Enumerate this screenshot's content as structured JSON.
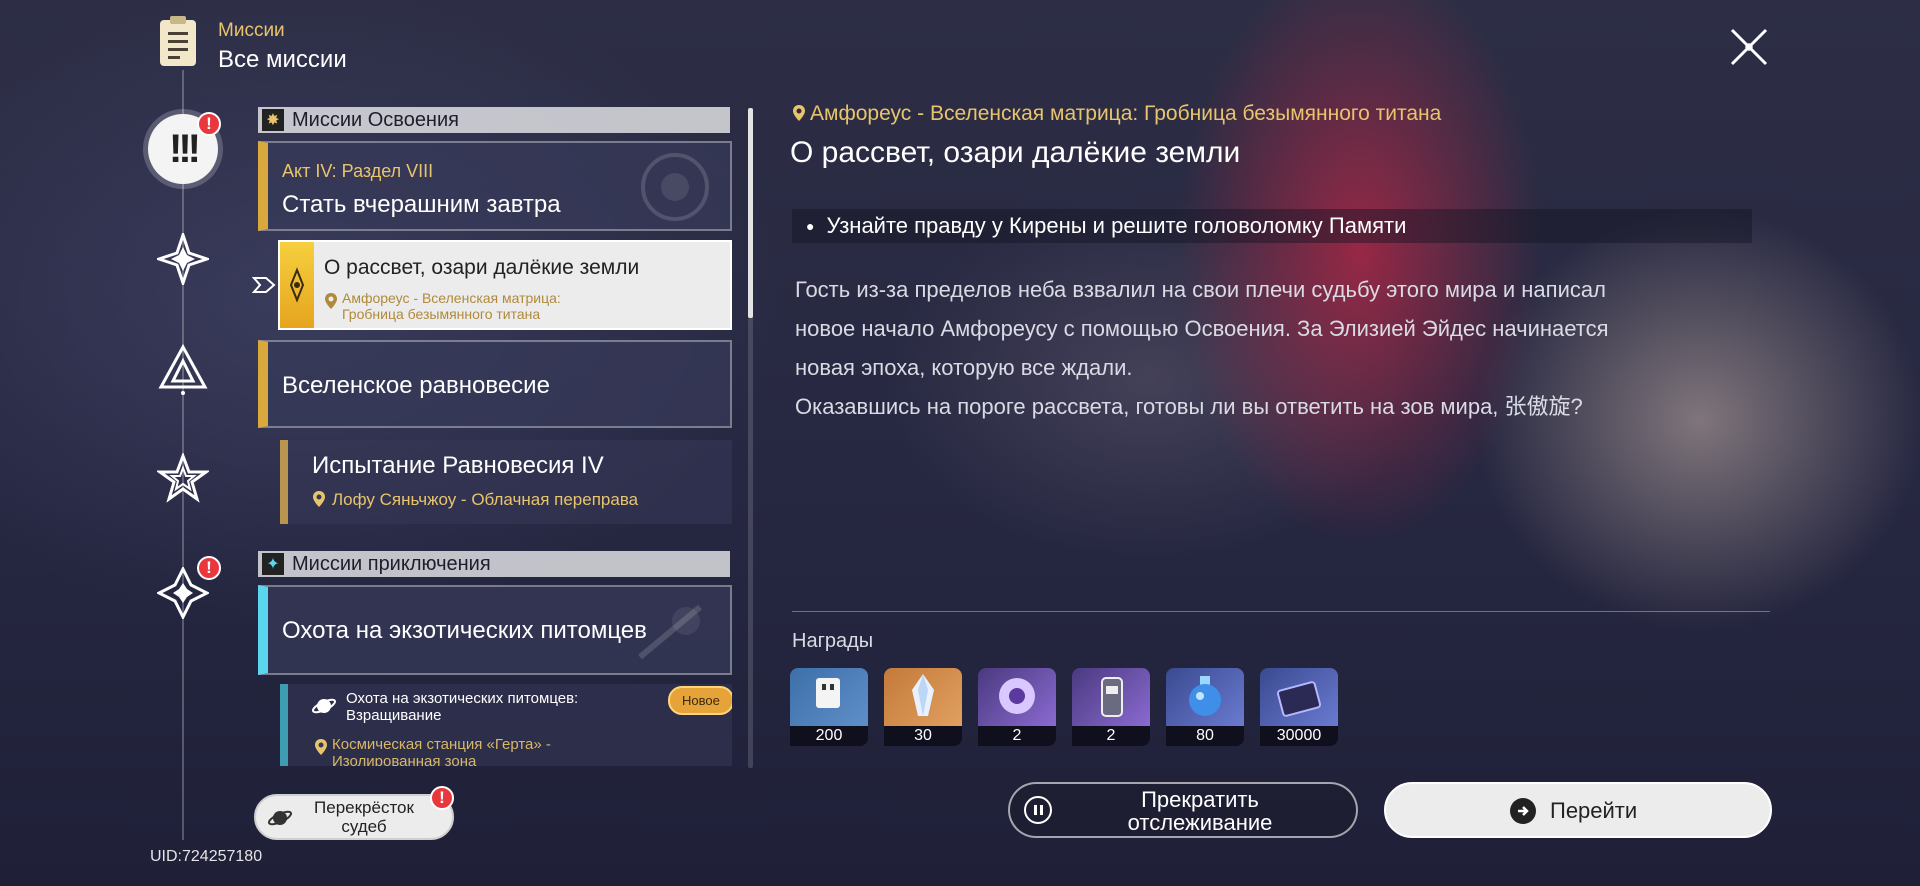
{
  "header": {
    "section": "Миссии",
    "title": "Все миссии"
  },
  "sections": {
    "trailblaze": "Миссии Освоения",
    "adventure": "Миссии приключения"
  },
  "quests": {
    "act": {
      "chapter": "Акт IV: Раздел VIII",
      "title": "Стать вчерашним завтра"
    },
    "selected": {
      "title": "О рассвет, озари далёкие земли",
      "location": "Амфореус - Вселенская матрица: Гробница безымянного титана"
    },
    "equilibrium": {
      "title": "Вселенское равновесие"
    },
    "trial": {
      "title": "Испытание Равновесия IV",
      "location": "Лофу Сяньчжоу - Облачная переправа"
    },
    "pets": {
      "title": "Охота на экзотических питомцев"
    },
    "pets_sub": {
      "title": "Охота на экзотических питомцев: Взращивание",
      "badge": "Новое",
      "location": "Космическая станция «Герта» - Изолированная зона"
    }
  },
  "detail": {
    "location": "Амфореус - Вселенская матрица: Гробница безымянного титана",
    "title": "О рассвет, озари далёкие земли",
    "objective": "Узнайте правду у Кирены и решите головоломку Памяти",
    "description_lines": [
      "Гость из-за пределов неба взвалил на свои плечи судьбу этого мира и написал",
      "новое начало Амфореусу с помощью Освоения. За Элизией Эйдес начинается",
      "новая эпоха, которую все ждали.",
      "Оказавшись на пороге рассвета, готовы ли вы ответить на зов мира, 张傲旋?"
    ],
    "rewards_label": "Награды",
    "rewards": [
      {
        "icon": "stellar-jade-icon",
        "count": "200",
        "color": "#3d6fa8"
      },
      {
        "icon": "crystal-icon",
        "count": "30",
        "color": "#c47a3a"
      },
      {
        "icon": "lightcone-material-icon",
        "count": "2",
        "color": "#6b4fa8"
      },
      {
        "icon": "relic-material-icon",
        "count": "2",
        "color": "#6b4fa8"
      },
      {
        "icon": "exp-potion-icon",
        "count": "80",
        "color": "#4f5ea8"
      },
      {
        "icon": "credits-icon",
        "count": "30000",
        "color": "#4f5ea8"
      }
    ]
  },
  "buttons": {
    "stop_tracking": "Прекратить отслеживание",
    "go": "Перейти",
    "fate": "Перекрёсток судеб"
  },
  "uid": "UID:724257180",
  "colors": {
    "accent_gold": "#e8c46c",
    "alert_red": "#e8383d",
    "adventure_cyan": "#5ad6ef"
  }
}
